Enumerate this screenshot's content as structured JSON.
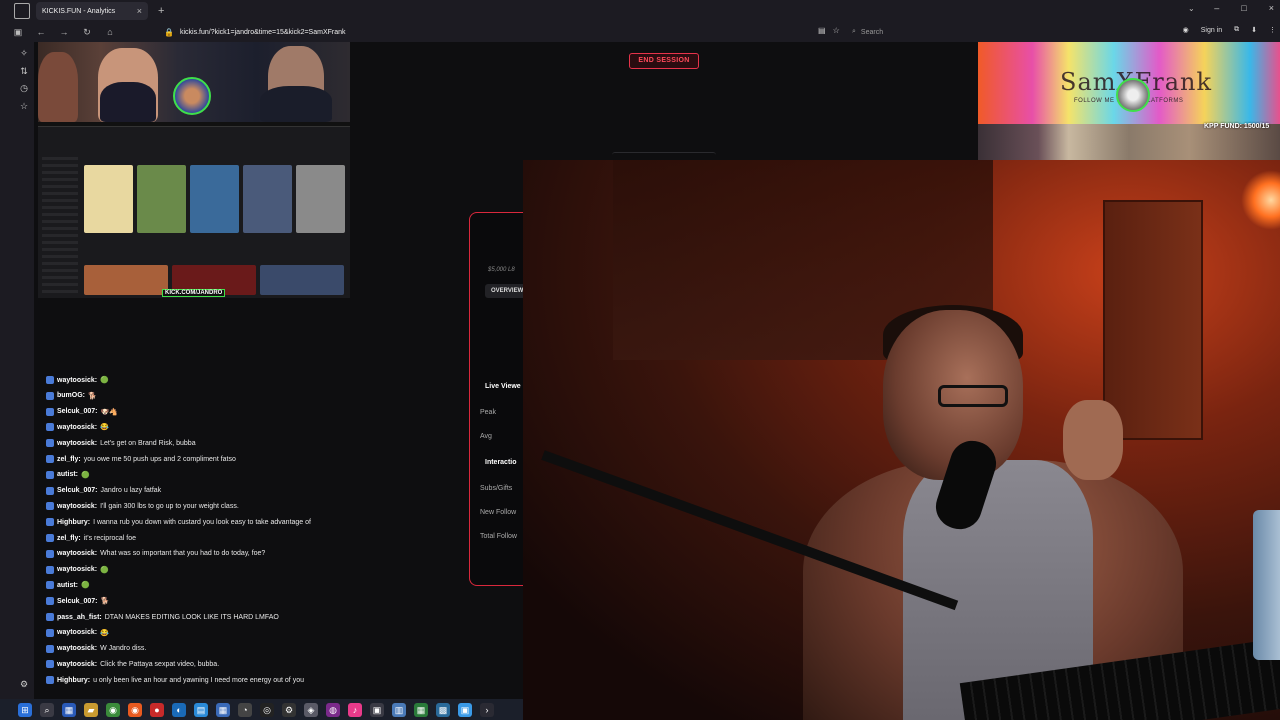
{
  "browser": {
    "tab_title": "KICKIS.FUN - Analytics",
    "tab_close": "×",
    "new_tab": "+",
    "url": "kickis.fun/?kick1=jandro&time=15&kick2=SamXFrank",
    "search_placeholder": "Search",
    "sign_in": "Sign in",
    "window_controls": [
      "–",
      "□",
      "×"
    ]
  },
  "dashboard": {
    "end_session_label": "END SESSION",
    "goal_text": "$5,000 L8",
    "overview_tab": "OVERVIEW",
    "live_viewers_heading": "Live Viewe",
    "peak_label": "Peak",
    "avg_label": "Avg",
    "interactions_heading": "Interactio",
    "subs_gifts_label": "Subs/Gifts",
    "new_follows_label": "New Follow",
    "total_follows_label": "Total Follow"
  },
  "banner": {
    "title": "SamXFrank",
    "subtitle": "FOLLOW ME ON ALL PLATFORMS",
    "fund": "KPP FUND: 1500/15"
  },
  "preview": {
    "kick_tag": "KICK.COM/JANDRO"
  },
  "chat": [
    {
      "user": "waytoosick:",
      "text": "",
      "emoji": "🟢"
    },
    {
      "user": "bumOG:",
      "text": "",
      "emoji": "🐕"
    },
    {
      "user": "Selcuk_007:",
      "text": "",
      "emoji": "🐶🐴"
    },
    {
      "user": "waytoosick:",
      "text": "",
      "emoji": "😂"
    },
    {
      "user": "waytoosick:",
      "text": "Let's get on Brand Risk, bubba",
      "emoji": ""
    },
    {
      "user": "zel_fly:",
      "text": "you owe me 50 push ups and 2 compliment fatso",
      "emoji": ""
    },
    {
      "user": "autist:",
      "text": "",
      "emoji": "🟢"
    },
    {
      "user": "Selcuk_007:",
      "text": "Jandro u lazy fatfak",
      "emoji": ""
    },
    {
      "user": "waytoosick:",
      "text": "I'll gain 300 lbs to go up to your weight class.",
      "emoji": ""
    },
    {
      "user": "Highbury:",
      "text": "I wanna rub you down with custard you look easy to take advantage of",
      "emoji": ""
    },
    {
      "user": "zel_fly:",
      "text": "it's reciprocal foe",
      "emoji": ""
    },
    {
      "user": "waytoosick:",
      "text": "What was so important that you had to do today, foe?",
      "emoji": ""
    },
    {
      "user": "waytoosick:",
      "text": "",
      "emoji": "🟢"
    },
    {
      "user": "autist:",
      "text": "",
      "emoji": "🟢"
    },
    {
      "user": "Selcuk_007:",
      "text": "",
      "emoji": "🐕"
    },
    {
      "user": "pass_ah_fist:",
      "text": "DTAN MAKES EDITING LOOK LIKE ITS HARD LMFAO",
      "emoji": ""
    },
    {
      "user": "waytoosick:",
      "text": "",
      "emoji": "😂"
    },
    {
      "user": "waytoosick:",
      "text": "W Jandro diss.",
      "emoji": ""
    },
    {
      "user": "waytoosick:",
      "text": "Click the Pattaya sexpat video, bubba.",
      "emoji": ""
    },
    {
      "user": "Highbury:",
      "text": "u only been live an hour and yawning I need more energy out of you",
      "emoji": ""
    }
  ]
}
